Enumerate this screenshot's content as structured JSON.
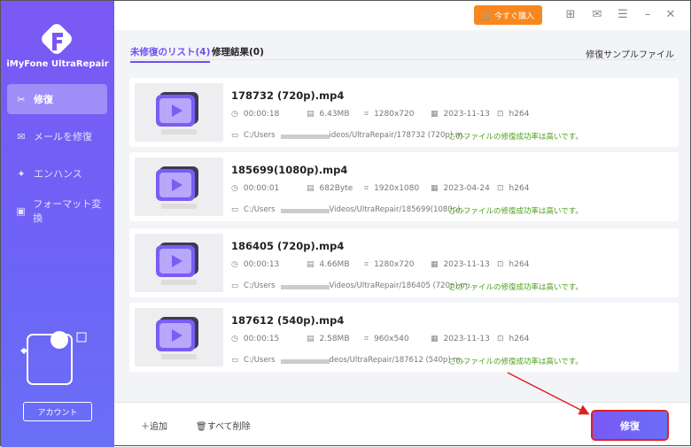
{
  "app": {
    "name": "iMyFone UltraRepair"
  },
  "sidebar": {
    "items": [
      {
        "label": "修復",
        "icon": "tools-icon",
        "active": true
      },
      {
        "label": "メールを修復",
        "icon": "mail-icon"
      },
      {
        "label": "エンハンス",
        "icon": "magic-wand-icon"
      },
      {
        "label": "フォーマット変換",
        "icon": "folder-convert-icon"
      }
    ],
    "account": "アカウント"
  },
  "topbar": {
    "buy": "今すぐ購入"
  },
  "tabs": [
    {
      "label": "未修復のリスト(4)",
      "active": true
    },
    {
      "label": "修理結果(0)"
    }
  ],
  "sample": "修復サンプルファイル",
  "files": [
    {
      "name": "178732 (720p).mp4",
      "duration": "00:00:18",
      "size": "6.43MB",
      "resolution": "1280x720",
      "date": "2023-11-13",
      "codec": "h264",
      "path_a": "C:/Users",
      "path_b": "ideos/UltraRepair/178732 (720p).m...",
      "status": "このファイルの修復成功率は高いです。"
    },
    {
      "name": "185699(1080p).mp4",
      "duration": "00:00:01",
      "size": "682Byte",
      "resolution": "1920x1080",
      "date": "2023-04-24",
      "codec": "h264",
      "path_a": "C:/Users",
      "path_b": "Videos/UltraRepair/185699(1080p)....",
      "status": "このファイルの修復成功率は高いです。"
    },
    {
      "name": "186405 (720p).mp4",
      "duration": "00:00:13",
      "size": "4.66MB",
      "resolution": "1280x720",
      "date": "2023-11-13",
      "codec": "h264",
      "path_a": "C:/Users",
      "path_b": "Videos/UltraRepair/186405 (720p).m...",
      "status": "このファイルの修復成功率は高いです。"
    },
    {
      "name": "187612 (540p).mp4",
      "duration": "00:00:15",
      "size": "2.58MB",
      "resolution": "960x540",
      "date": "2023-11-13",
      "codec": "h264",
      "path_a": "C:/Users",
      "path_b": "deos/UltraRepair/187612 (540p).m...",
      "status": "このファイルの修復成功率は高いです。"
    }
  ],
  "bottom": {
    "add": "追加",
    "delete_all": "すべて削除",
    "repair": "修復"
  },
  "colors": {
    "accent": "#6b52f0",
    "buy": "#f8871f",
    "success": "#4e9e1c",
    "annotation": "#e02020"
  }
}
